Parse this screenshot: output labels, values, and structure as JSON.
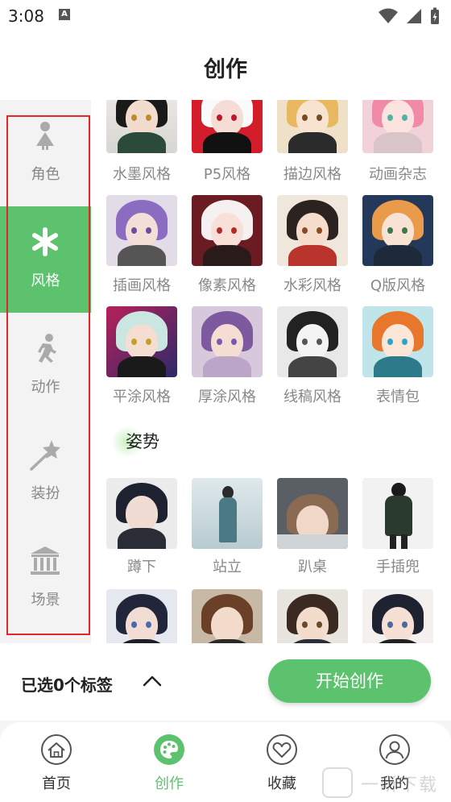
{
  "status": {
    "time": "3:08",
    "notif_badge": "A"
  },
  "header": {
    "title": "创作"
  },
  "sidebar": {
    "items": [
      {
        "label": "角色",
        "icon": "person-icon"
      },
      {
        "label": "风格",
        "icon": "asterisk-icon"
      },
      {
        "label": "动作",
        "icon": "running-icon"
      },
      {
        "label": "装扮",
        "icon": "magic-wand-icon"
      },
      {
        "label": "场景",
        "icon": "museum-icon"
      }
    ],
    "active_index": 1
  },
  "styles": {
    "items": [
      {
        "label": "水墨风格"
      },
      {
        "label": "P5风格"
      },
      {
        "label": "描边风格"
      },
      {
        "label": "动画杂志"
      },
      {
        "label": "插画风格"
      },
      {
        "label": "像素风格"
      },
      {
        "label": "水彩风格"
      },
      {
        "label": "Q版风格"
      },
      {
        "label": "平涂风格"
      },
      {
        "label": "厚涂风格"
      },
      {
        "label": "线稿风格"
      },
      {
        "label": "表情包"
      }
    ]
  },
  "poses": {
    "title": "姿势",
    "items": [
      {
        "label": "蹲下"
      },
      {
        "label": "站立"
      },
      {
        "label": "趴桌"
      },
      {
        "label": "手插兜"
      }
    ]
  },
  "action_bar": {
    "selected_label": "已选0个标签",
    "start_label": "开始创作"
  },
  "tabbar": {
    "tabs": [
      {
        "label": "首页",
        "icon": "home-icon"
      },
      {
        "label": "创作",
        "icon": "palette-icon"
      },
      {
        "label": "收藏",
        "icon": "heart-icon"
      },
      {
        "label": "我的",
        "icon": "user-icon"
      }
    ],
    "active_index": 1
  },
  "colors": {
    "accent": "#5dc26e",
    "highlight_frame": "#e3262a"
  }
}
